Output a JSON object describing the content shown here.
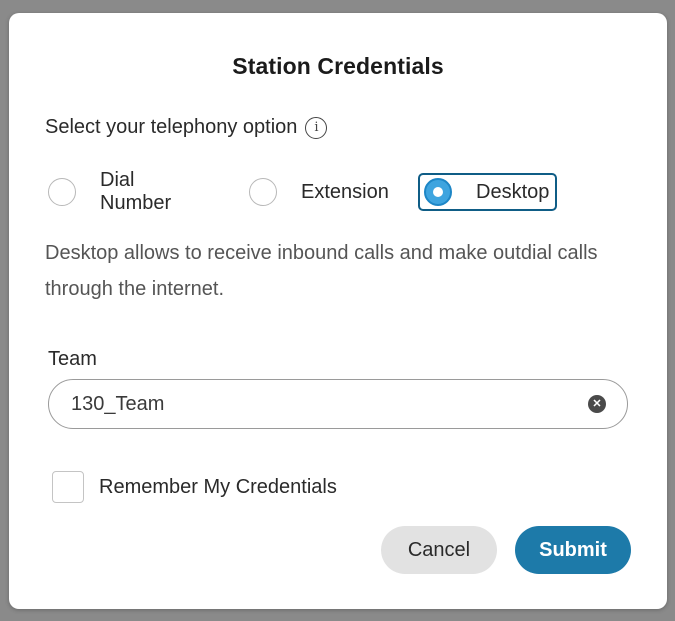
{
  "dialog": {
    "title": "Station Credentials",
    "prompt": "Select your telephony option",
    "info_icon": "info-icon",
    "telephony_options": [
      {
        "label": "Dial Number",
        "selected": false
      },
      {
        "label": "Extension",
        "selected": false
      },
      {
        "label": "Desktop",
        "selected": true
      }
    ],
    "description": "Desktop allows to receive inbound calls and make outdial calls through the internet.",
    "team": {
      "label": "Team",
      "value": "130_Team",
      "clear_icon": "clear-icon"
    },
    "remember": {
      "label": "Remember My Credentials",
      "checked": false
    },
    "buttons": {
      "cancel": "Cancel",
      "submit": "Submit"
    },
    "colors": {
      "accent": "#1d7aa9",
      "selected_radio": "#3ea4df",
      "selected_border": "#0f5d86"
    }
  }
}
